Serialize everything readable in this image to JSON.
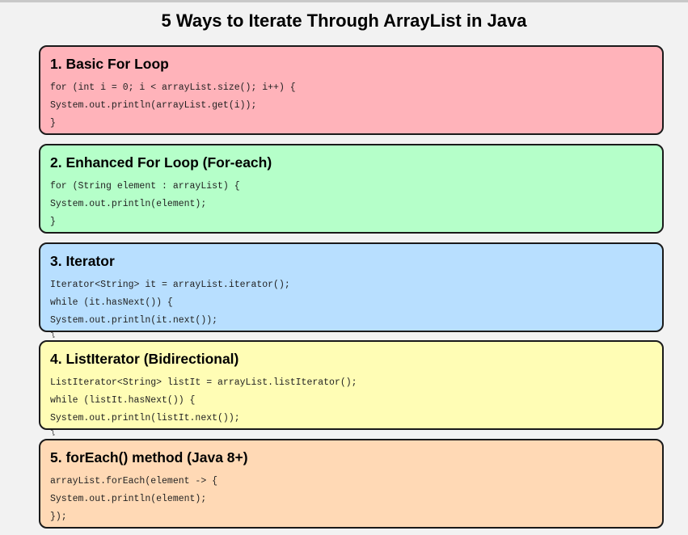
{
  "title": "5 Ways to Iterate Through ArrayList in Java",
  "colors": {
    "red": "#ffb3ba",
    "green": "#b5ffc9",
    "blue": "#b8dfff",
    "yellow": "#fffdb5",
    "orange": "#ffd9b5"
  },
  "methods": [
    {
      "title": "1. Basic For Loop",
      "code": [
        "for (int i = 0; i < arrayList.size(); i++) {",
        "System.out.println(arrayList.get(i));",
        "}"
      ]
    },
    {
      "title": "2. Enhanced For Loop (For-each)",
      "code": [
        "for (String element : arrayList) {",
        "System.out.println(element);",
        "}"
      ]
    },
    {
      "title": "3. Iterator",
      "code": [
        "Iterator<String> it = arrayList.iterator();",
        "while (it.hasNext()) {",
        "System.out.println(it.next());",
        "}"
      ]
    },
    {
      "title": "4. ListIterator (Bidirectional)",
      "code": [
        "ListIterator<String> listIt = arrayList.listIterator();",
        "while (listIt.hasNext()) {",
        "System.out.println(listIt.next());",
        "}"
      ]
    },
    {
      "title": "5. forEach() method (Java 8+)",
      "code": [
        "arrayList.forEach(element -> {",
        "System.out.println(element);",
        "});"
      ]
    }
  ]
}
